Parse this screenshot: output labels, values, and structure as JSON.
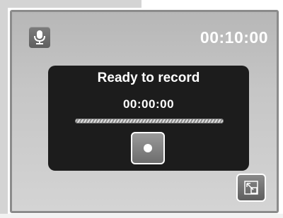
{
  "header": {
    "mic_icon": "microphone-icon",
    "total_time": "00:10:00"
  },
  "recorder": {
    "status": "Ready to record",
    "elapsed": "00:00:00",
    "progress_fraction": 0,
    "record_icon": "record-dot-icon"
  },
  "footer": {
    "resize_icon": "resize-icon"
  },
  "colors": {
    "panel_border": "#8b8b8b",
    "recorder_background": "#1c1c1c",
    "text": "#ffffff"
  }
}
